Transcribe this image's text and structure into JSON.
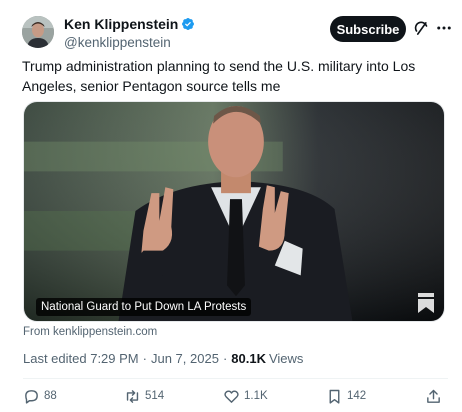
{
  "author": {
    "name": "Ken Klippenstein",
    "handle": "@kenklippenstein",
    "verified": true
  },
  "header": {
    "subscribe_label": "Subscribe"
  },
  "tweet": {
    "text": "Trump administration planning to send the U.S. military into Los Angeles, senior Pentagon source tells me"
  },
  "card": {
    "title": "National Guard to Put Down LA Protests",
    "source": "From kenklippenstein.com"
  },
  "meta": {
    "edited": "Last edited 7:29 PM",
    "separator": "·",
    "date": "Jun 7, 2025",
    "views_count": "80.1K",
    "views_label": "Views"
  },
  "actions": {
    "replies": "88",
    "reposts": "514",
    "likes": "1.1K",
    "bookmarks": "142"
  },
  "colors": {
    "verified": "#1d9bf0",
    "text": "#0f1419",
    "secondary": "#536471"
  },
  "icons": [
    "verified-badge-icon",
    "grok-icon",
    "more-icon",
    "bookmark-icon",
    "reply-icon",
    "repost-icon",
    "like-icon",
    "share-icon"
  ]
}
